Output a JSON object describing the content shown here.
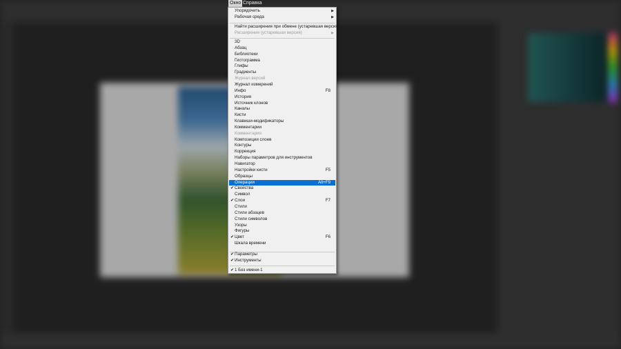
{
  "menubar": {
    "window_label": "Окно",
    "help_label": "Справка"
  },
  "menu": {
    "arrange": "Упорядочить",
    "workspace": "Рабочая среда",
    "find_extensions": "Найти расширения при обмене (устаревшая версия)...",
    "extensions_legacy": "Расширения (устаревшая версия)",
    "items": [
      {
        "label": "3D"
      },
      {
        "label": "Абзац"
      },
      {
        "label": "Библиотеки"
      },
      {
        "label": "Гистограмма"
      },
      {
        "label": "Глифы"
      },
      {
        "label": "Градиенты"
      },
      {
        "label": "Журнал версий",
        "disabled": true
      },
      {
        "label": "Журнал измерений"
      },
      {
        "label": "Инфо",
        "shortcut": "F8"
      },
      {
        "label": "История"
      },
      {
        "label": "Источник клонов"
      },
      {
        "label": "Каналы"
      },
      {
        "label": "Кисти"
      },
      {
        "label": "Клавиши-модификаторы"
      },
      {
        "label": "Комментарии"
      },
      {
        "label": "Комментарии",
        "disabled": true
      },
      {
        "label": "Композиции слоев"
      },
      {
        "label": "Контуры"
      },
      {
        "label": "Коррекция"
      },
      {
        "label": "Наборы параметров для инструментов"
      },
      {
        "label": "Навигатор"
      },
      {
        "label": "Настройки кисти",
        "shortcut": "F5"
      },
      {
        "label": "Образцы"
      },
      {
        "label": "Операции",
        "shortcut": "Alt+F9",
        "highlighted": true
      },
      {
        "label": "Свойства",
        "checked": true
      },
      {
        "label": "Символ"
      },
      {
        "label": "Слои",
        "shortcut": "F7",
        "checked": true
      },
      {
        "label": "Стили"
      },
      {
        "label": "Стили абзацев"
      },
      {
        "label": "Стили символов"
      },
      {
        "label": "Узоры"
      },
      {
        "label": "Фигуры"
      },
      {
        "label": "Цвет",
        "shortcut": "F6",
        "checked": true
      },
      {
        "label": "Шкала времени"
      }
    ],
    "options": "Параметры",
    "tools": "Инструменты",
    "document": "1 Без имени-1"
  },
  "icons": {
    "check": "checkmark-icon",
    "submenu": "submenu-arrow-icon"
  },
  "colors": {
    "highlight": "#0a6fd1",
    "menu_bg": "#f0f0f0"
  }
}
